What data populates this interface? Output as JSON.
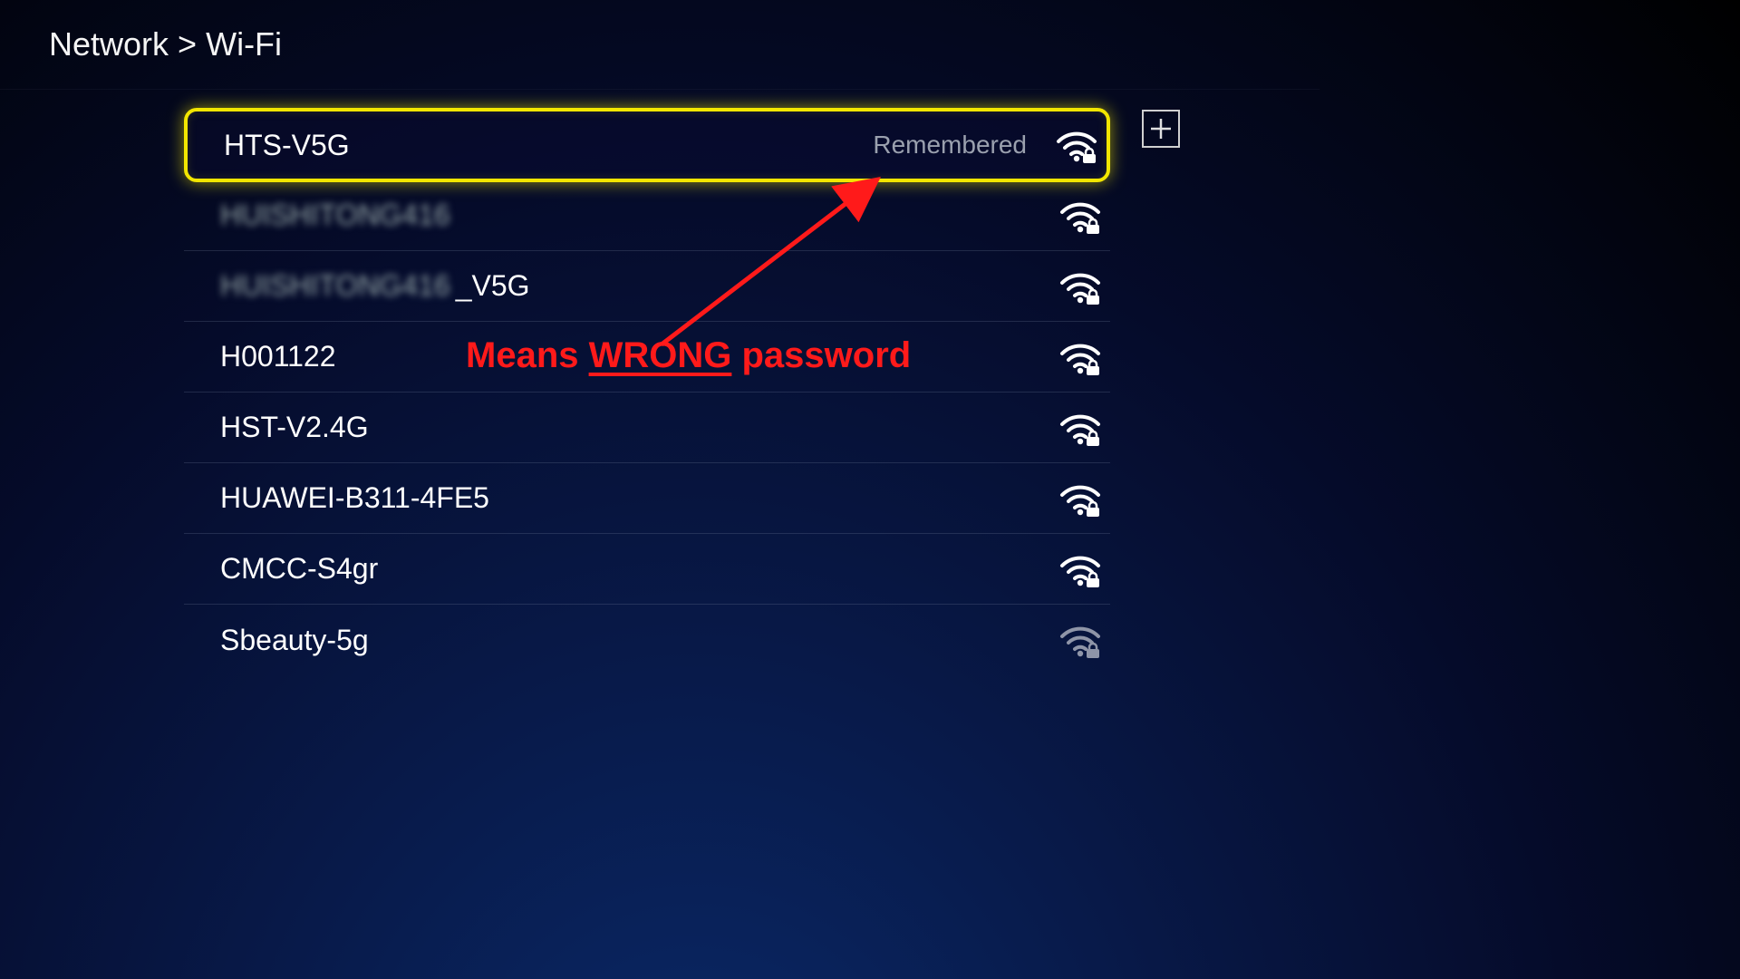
{
  "breadcrumb": {
    "parent": "Network",
    "sep": ">",
    "current": "Wi-Fi"
  },
  "networks": [
    {
      "ssid": "HTS-V5G",
      "status": "Remembered",
      "secured": true,
      "selected": true,
      "blurred": false,
      "suffix": "",
      "dim": false
    },
    {
      "ssid": "HUISHITONG416",
      "status": "",
      "secured": true,
      "selected": false,
      "blurred": true,
      "suffix": "",
      "dim": false
    },
    {
      "ssid": "HUISHITONG416",
      "status": "",
      "secured": true,
      "selected": false,
      "blurred": true,
      "suffix": "_V5G",
      "dim": false
    },
    {
      "ssid": "H001122",
      "status": "",
      "secured": true,
      "selected": false,
      "blurred": false,
      "suffix": "",
      "dim": false
    },
    {
      "ssid": "HST-V2.4G",
      "status": "",
      "secured": true,
      "selected": false,
      "blurred": false,
      "suffix": "",
      "dim": false
    },
    {
      "ssid": "HUAWEI-B311-4FE5",
      "status": "",
      "secured": true,
      "selected": false,
      "blurred": false,
      "suffix": "",
      "dim": false
    },
    {
      "ssid": "CMCC-S4gr",
      "status": "",
      "secured": true,
      "selected": false,
      "blurred": false,
      "suffix": "",
      "dim": false
    },
    {
      "ssid": "Sbeauty-5g",
      "status": "",
      "secured": true,
      "selected": false,
      "blurred": false,
      "suffix": "",
      "dim": true
    }
  ],
  "annotation": {
    "prefix": "Means ",
    "emphasis": "WRONG",
    "suffix": " password",
    "color": "#ff1a1a"
  }
}
